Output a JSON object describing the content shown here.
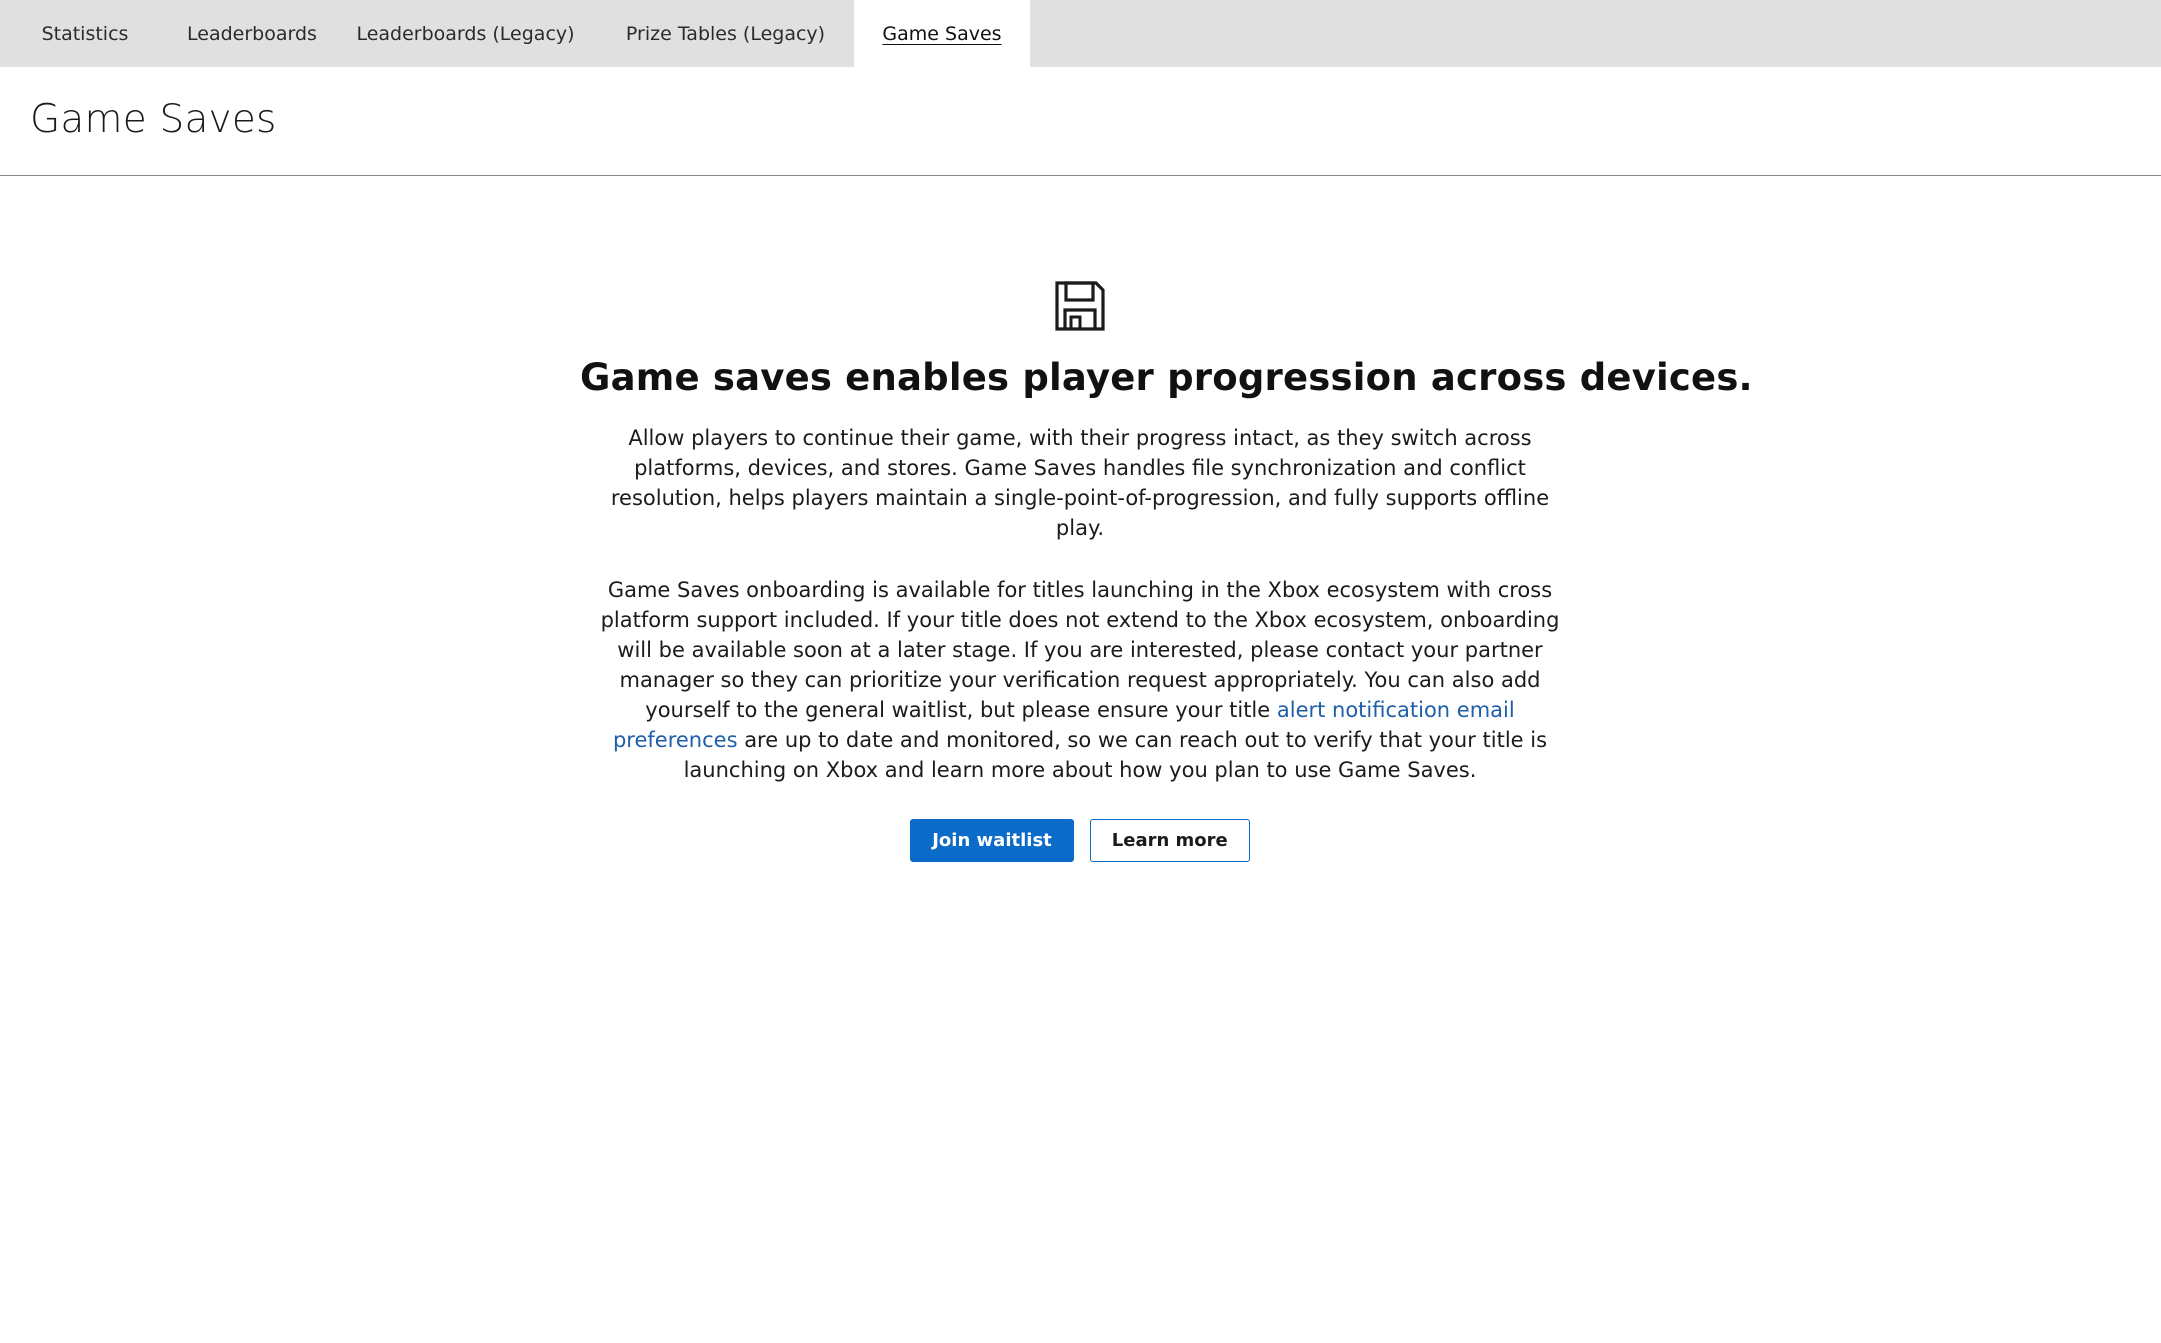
{
  "tabs": [
    {
      "label": "Statistics"
    },
    {
      "label": "Leaderboards"
    },
    {
      "label": "Leaderboards (Legacy)"
    },
    {
      "label": "Prize Tables (Legacy)"
    },
    {
      "label": "Game Saves",
      "active": true
    }
  ],
  "page": {
    "title": "Game Saves"
  },
  "empty_state": {
    "icon": "floppy-disk-icon",
    "headline": "Game saves enables player progression across devices.",
    "paragraph1": "Allow players to continue their game, with their progress intact, as they switch across platforms, devices, and stores. Game Saves handles file synchronization and conflict resolution, helps players maintain a single-point-of-progression, and fully supports offline play.",
    "paragraph2_before": "Game Saves onboarding is available for titles launching in the Xbox ecosystem with cross platform support included. If your title does not extend to the Xbox ecosystem, onboarding will be available soon at a later stage. If you are interested, please contact your partner manager so they can prioritize your verification request appropriately. You can also add yourself to the general waitlist, but please ensure your title ",
    "paragraph2_link": "alert notification email preferences",
    "paragraph2_after": " are up to date and monitored, so we can reach out to verify that your title is launching on Xbox and learn more about how you plan to use Game Saves.",
    "primary_button": "Join waitlist",
    "secondary_button": "Learn more"
  },
  "colors": {
    "accent": "#0b6bc9",
    "link": "#1f5ea8",
    "tabbar_bg": "#e0e0e0"
  }
}
